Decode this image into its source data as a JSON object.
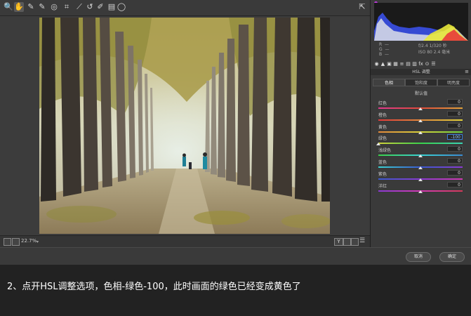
{
  "toolbar": {
    "tools": [
      {
        "name": "zoom-icon",
        "glyph": "🔍"
      },
      {
        "name": "hand-icon",
        "glyph": "✋"
      },
      {
        "name": "white-balance-icon",
        "glyph": "✎"
      },
      {
        "name": "color-sampler-icon",
        "glyph": "✎"
      },
      {
        "name": "targeted-adjust-icon",
        "glyph": "◎"
      },
      {
        "name": "crop-icon",
        "glyph": "⌗"
      },
      {
        "name": "straighten-icon",
        "glyph": "⟋"
      },
      {
        "name": "spot-removal-icon",
        "glyph": "↺"
      },
      {
        "name": "brush-icon",
        "glyph": "✐"
      },
      {
        "name": "graduated-filter-icon",
        "glyph": "▤"
      },
      {
        "name": "radial-filter-icon",
        "glyph": "◯"
      }
    ],
    "fullscreen_icon": "⇱"
  },
  "camera_info": {
    "col1": [
      "R",
      "G",
      "B"
    ],
    "col1_vals": [
      "—",
      "—",
      "—"
    ],
    "aperture_shutter": "f/2.4   1/320 秒",
    "iso_lens": "ISO 80   2.4 毫米"
  },
  "panel": {
    "icons": [
      "◉",
      "▲",
      "▣",
      "▦",
      "≡",
      "▤",
      "▥",
      "fx",
      "⊙",
      "☰"
    ],
    "title": "HSL 调整",
    "tabs": [
      "色相",
      "饱和度",
      "明亮度"
    ],
    "default_link": "默认值",
    "sliders": [
      {
        "label": "红色",
        "value": "0",
        "pos": 0.5,
        "gradient": [
          "#e23a8f",
          "#e24a3a",
          "#e2a23a"
        ]
      },
      {
        "label": "橙色",
        "value": "0",
        "pos": 0.5,
        "gradient": [
          "#e23a3a",
          "#e2883a",
          "#e2d23a"
        ]
      },
      {
        "label": "黄色",
        "value": "0",
        "pos": 0.5,
        "gradient": [
          "#e2883a",
          "#d8d23a",
          "#6ad23a"
        ]
      },
      {
        "label": "绿色",
        "value": "-100",
        "pos": 0.0,
        "highlight": true,
        "gradient": [
          "#d2d23a",
          "#3ad24a",
          "#3ad2b2"
        ]
      },
      {
        "label": "浅绿色",
        "value": "0",
        "pos": 0.5,
        "gradient": [
          "#3ad24a",
          "#3ad2d2",
          "#3a8ad2"
        ]
      },
      {
        "label": "蓝色",
        "value": "0",
        "pos": 0.5,
        "gradient": [
          "#3ad2d2",
          "#3a5ad2",
          "#8a3ad2"
        ]
      },
      {
        "label": "紫色",
        "value": "0",
        "pos": 0.5,
        "gradient": [
          "#3a5ad2",
          "#8a3ad2",
          "#d23ab2"
        ]
      },
      {
        "label": "洋红",
        "value": "0",
        "pos": 0.5,
        "gradient": [
          "#8a3ad2",
          "#d23ab2",
          "#d23a5a"
        ]
      }
    ]
  },
  "view": {
    "zoom": "22.7%",
    "compare_label": "Y"
  },
  "actions": {
    "cancel": "取消",
    "ok": "确定"
  },
  "caption": "2、点开HSL调整选项，色相-绿色-100，此时画面的绿色已经变成黄色了",
  "colors": {
    "accent": "#3a7bd5",
    "background": "#2a2a2a",
    "panel": "#3a3a3a"
  }
}
